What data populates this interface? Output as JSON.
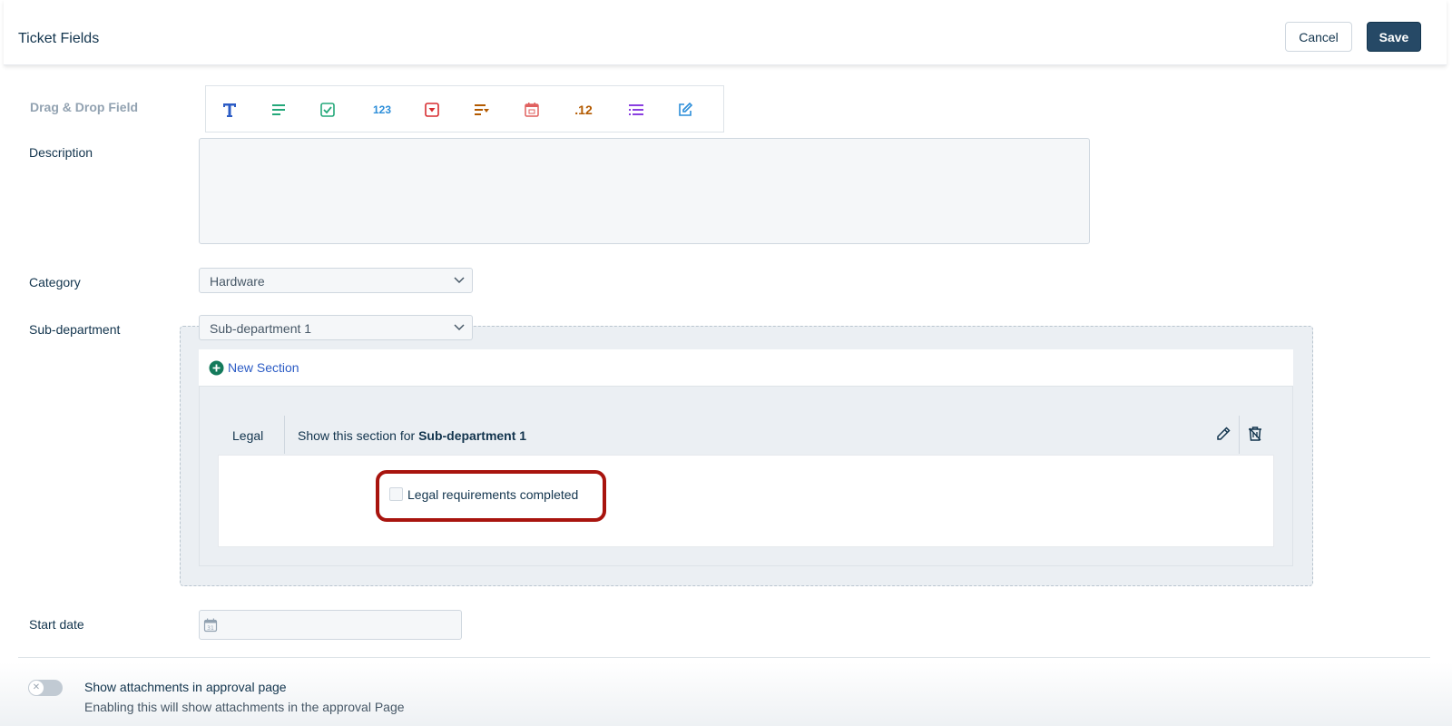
{
  "header": {
    "title": "Ticket Fields",
    "cancel_label": "Cancel",
    "save_label": "Save"
  },
  "toolbar": {
    "label": "Drag & Drop Field",
    "items": [
      {
        "icon": "text-field-icon",
        "color": "#2c5cc5"
      },
      {
        "icon": "paragraph-field-icon",
        "color": "#24a87a"
      },
      {
        "icon": "checkbox-field-icon",
        "color": "#24a87a"
      },
      {
        "icon": "number-field-icon",
        "text": "123",
        "color": "#2c8ed9"
      },
      {
        "icon": "dropdown-field-icon",
        "color": "#d72d30"
      },
      {
        "icon": "dependent-field-icon",
        "color": "#b35a00"
      },
      {
        "icon": "date-field-icon",
        "color": "#e0605f"
      },
      {
        "icon": "decimal-field-icon",
        "text": ".12",
        "color": "#b35a00"
      },
      {
        "icon": "multiselect-field-icon",
        "color": "#8a3fe0"
      },
      {
        "icon": "edit-field-icon",
        "color": "#2c8ed9"
      }
    ]
  },
  "form": {
    "description_label": "Description",
    "category_label": "Category",
    "category_value": "Hardware",
    "subdept_label": "Sub-department",
    "subdept_value": "Sub-department 1",
    "start_date_label": "Start date"
  },
  "sections": {
    "new_section_label": "New Section",
    "section": {
      "name": "Legal",
      "show_prefix": "Show this section for",
      "show_value": "Sub-department 1",
      "field_label": "Legal requirements completed"
    }
  },
  "attachments": {
    "title": "Show attachments in approval page",
    "subtitle": "Enabling this will show attachments in the approval Page"
  },
  "colors": {
    "primary": "#264966",
    "link": "#2c5cc5",
    "highlight": "#a8140e",
    "plus_green": "#147a5b"
  }
}
